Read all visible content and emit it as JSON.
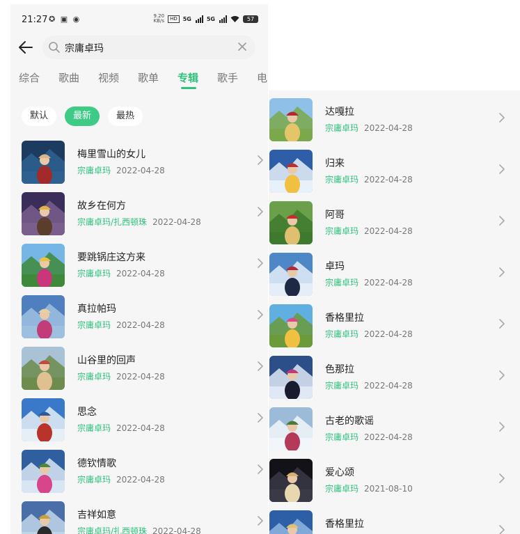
{
  "status_bar": {
    "time": "21:27",
    "mini_top": "9.20",
    "mini_bottom": "KB/s",
    "battery": "57"
  },
  "search": {
    "query": "宗庸卓玛"
  },
  "tabs": [
    {
      "label": "综合",
      "active": false
    },
    {
      "label": "歌曲",
      "active": false
    },
    {
      "label": "视频",
      "active": false
    },
    {
      "label": "歌单",
      "active": false
    },
    {
      "label": "专辑",
      "active": true
    },
    {
      "label": "歌手",
      "active": false
    },
    {
      "label": "电",
      "active": false
    }
  ],
  "sort": [
    {
      "label": "默认",
      "active": false
    },
    {
      "label": "最新",
      "active": true
    },
    {
      "label": "最热",
      "active": false
    }
  ],
  "albums_left": [
    {
      "title": "梅里雪山的女儿",
      "artist": "宗庸卓玛",
      "date": "2022-04-28"
    },
    {
      "title": "故乡在何方",
      "artist": "宗庸卓玛/扎西顿珠",
      "date": "2022-04-28"
    },
    {
      "title": "要跳锅庄这方来",
      "artist": "宗庸卓玛",
      "date": "2022-04-28"
    },
    {
      "title": "真拉帕玛",
      "artist": "宗庸卓玛",
      "date": "2022-04-28"
    },
    {
      "title": "山谷里的回声",
      "artist": "宗庸卓玛",
      "date": "2022-04-28"
    },
    {
      "title": "思念",
      "artist": "宗庸卓玛",
      "date": "2022-04-28"
    },
    {
      "title": "德钦情歌",
      "artist": "宗庸卓玛",
      "date": "2022-04-28"
    },
    {
      "title": "吉祥如意",
      "artist": "宗庸卓玛/扎西顿珠",
      "date": "2022-04-28"
    }
  ],
  "albums_right": [
    {
      "title": "达嘎拉",
      "artist": "宗庸卓玛",
      "date": "2022-04-28"
    },
    {
      "title": "归来",
      "artist": "宗庸卓玛",
      "date": "2022-04-28"
    },
    {
      "title": "阿哥",
      "artist": "宗庸卓玛",
      "date": "2022-04-28"
    },
    {
      "title": "卓玛",
      "artist": "宗庸卓玛",
      "date": "2022-04-28"
    },
    {
      "title": "香格里拉",
      "artist": "宗庸卓玛",
      "date": "2022-04-28"
    },
    {
      "title": "色那拉",
      "artist": "宗庸卓玛",
      "date": "2022-04-28"
    },
    {
      "title": "古老的歌谣",
      "artist": "宗庸卓玛",
      "date": "2022-04-28"
    },
    {
      "title": "爱心颂",
      "artist": "宗庸卓玛",
      "date": "2021-08-10"
    },
    {
      "title": "香格里拉",
      "artist": "",
      "date": ""
    }
  ],
  "colors": {
    "accent": "#2fc27c",
    "page_bg": "#f6f6f6",
    "muted_text": "#777777"
  }
}
